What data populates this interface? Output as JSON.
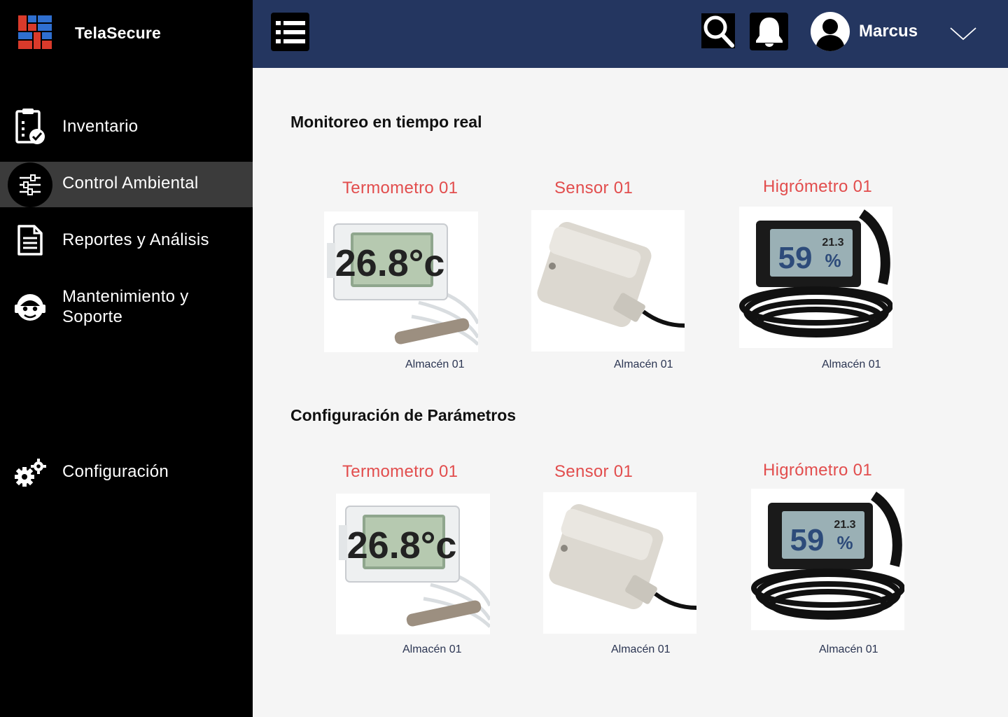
{
  "brand": {
    "name": "TelaSecure"
  },
  "sidebar": {
    "items": [
      {
        "label": "Inventario",
        "icon": "clipboard-check-icon"
      },
      {
        "label": "Control Ambiental",
        "icon": "sliders-icon",
        "active": true
      },
      {
        "label": "Reportes y Análisis",
        "icon": "document-icon"
      },
      {
        "label": "Mantenimiento y Soporte",
        "icon": "support-agent-icon"
      },
      {
        "label": "Configuración",
        "icon": "gears-icon"
      }
    ]
  },
  "header": {
    "user_name": "Marcus",
    "icons": [
      "menu-icon",
      "search-icon",
      "bell-icon",
      "avatar",
      "chevron-down-icon"
    ]
  },
  "sections": {
    "monitoring": {
      "title": "Monitoreo en tiempo real",
      "devices": [
        {
          "name": "Termometro 01",
          "location": "Almacén 01",
          "display": "26.8°c"
        },
        {
          "name": "Sensor 01",
          "location": "Almacén 01"
        },
        {
          "name": "Higrómetro 01",
          "location": "Almacén 01",
          "display_main": "59",
          "display_sub": "21.3",
          "display_unit": "%"
        }
      ]
    },
    "config": {
      "title": "Configuración de Parámetros",
      "devices": [
        {
          "name": "Termometro 01",
          "location": "Almacén 01",
          "display": "26.8°c"
        },
        {
          "name": "Sensor 01",
          "location": "Almacén 01"
        },
        {
          "name": "Higrómetro 01",
          "location": "Almacén 01",
          "display_main": "59",
          "display_sub": "21.3",
          "display_unit": "%"
        }
      ]
    }
  },
  "colors": {
    "sidebar_bg": "#000000",
    "topbar_bg": "#243660",
    "active_item_bg": "#3b3b3b",
    "device_title": "#e24d4d",
    "logo_red": "#d93a2b",
    "logo_blue": "#2f6fd0"
  }
}
